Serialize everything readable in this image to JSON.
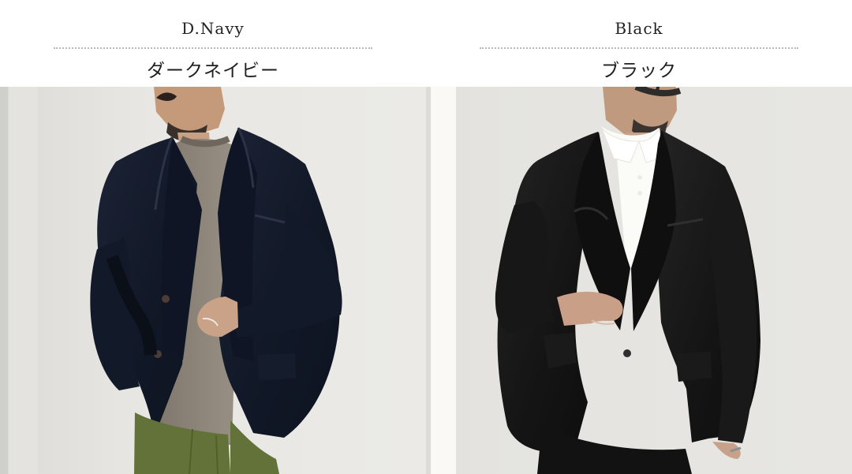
{
  "variants": [
    {
      "name_en": "D.Navy",
      "name_ja": "ダークネイビー",
      "swatch": "#111827"
    },
    {
      "name_en": "Black",
      "name_ja": "ブラック",
      "swatch": "#111111"
    }
  ],
  "colors": {
    "background": "#ffffff",
    "divider_dots": "#b9b9b9",
    "wall_light": "#ebeae6",
    "knit_gray": "#8f877d",
    "pants_olive": "#637238",
    "polo_white": "#fbfbf8",
    "skin": "#d2a989"
  }
}
